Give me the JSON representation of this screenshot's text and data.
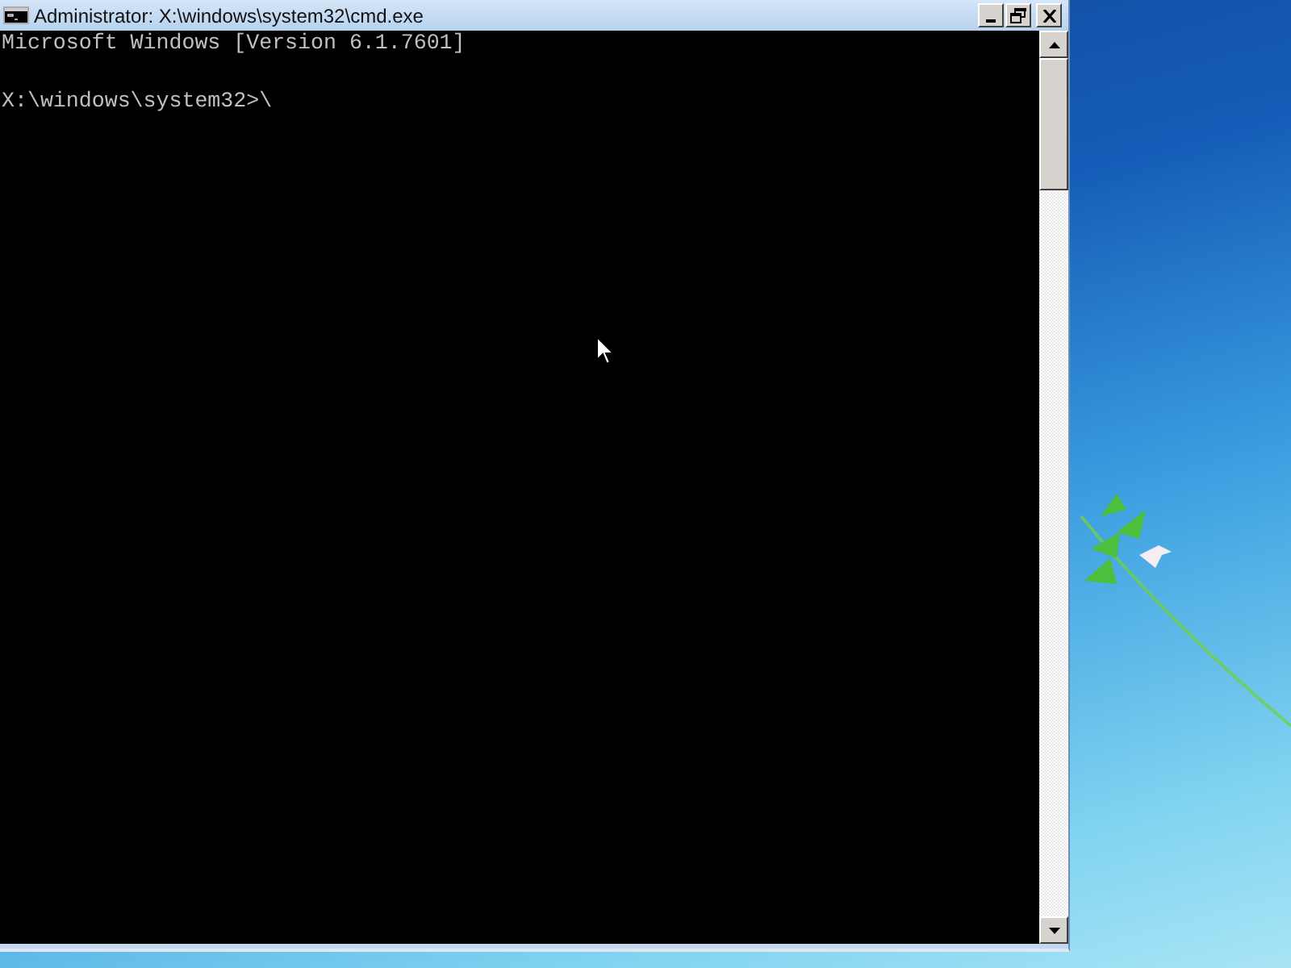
{
  "window": {
    "title": "Administrator: X:\\windows\\system32\\cmd.exe"
  },
  "console": {
    "output_lines": [
      "Microsoft Windows [Version 6.1.7601]"
    ],
    "prompt": "X:\\windows\\system32>\\"
  }
}
